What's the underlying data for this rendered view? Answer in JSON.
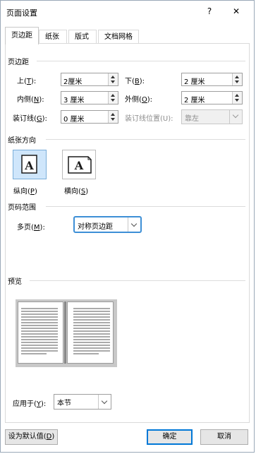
{
  "dialog": {
    "title": "页面设置",
    "help_glyph": "?",
    "close_glyph": "✕"
  },
  "tabs": [
    {
      "label": "页边距"
    },
    {
      "label": "纸张"
    },
    {
      "label": "版式"
    },
    {
      "label": "文档网格"
    }
  ],
  "margins": {
    "group_title": "页边距",
    "top_label": "上",
    "top_key": "T",
    "top_value": "2厘米",
    "bottom_label": "下",
    "bottom_key": "B",
    "bottom_value": "2 厘米",
    "inside_label": "内侧",
    "inside_key": "N",
    "inside_value": "3 厘米",
    "outside_label": "外侧",
    "outside_key": "O",
    "outside_value": "2 厘米",
    "gutter_label": "装订线",
    "gutter_key": "G",
    "gutter_value": "0 厘米",
    "gutter_pos_label": "装订线位置(U):",
    "gutter_pos_value": "靠左"
  },
  "orientation": {
    "group_title": "纸张方向",
    "portrait_label": "纵向",
    "portrait_key": "P",
    "landscape_label": "横向",
    "landscape_key": "S",
    "icon_letter": "A",
    "selected": "portrait"
  },
  "pages": {
    "group_title": "页码范围",
    "multi_label": "多页",
    "multi_key": "M",
    "multi_value": "对称页边距"
  },
  "preview": {
    "group_title": "预览",
    "apply_label": "应用于",
    "apply_key": "Y",
    "apply_value": "本节"
  },
  "footer": {
    "default_label": "设为默认值",
    "default_key": "D",
    "ok_label": "确定",
    "cancel_label": "取消"
  },
  "colors": {
    "accent": "#0078d7",
    "selected_bg": "#cfe6fb"
  }
}
